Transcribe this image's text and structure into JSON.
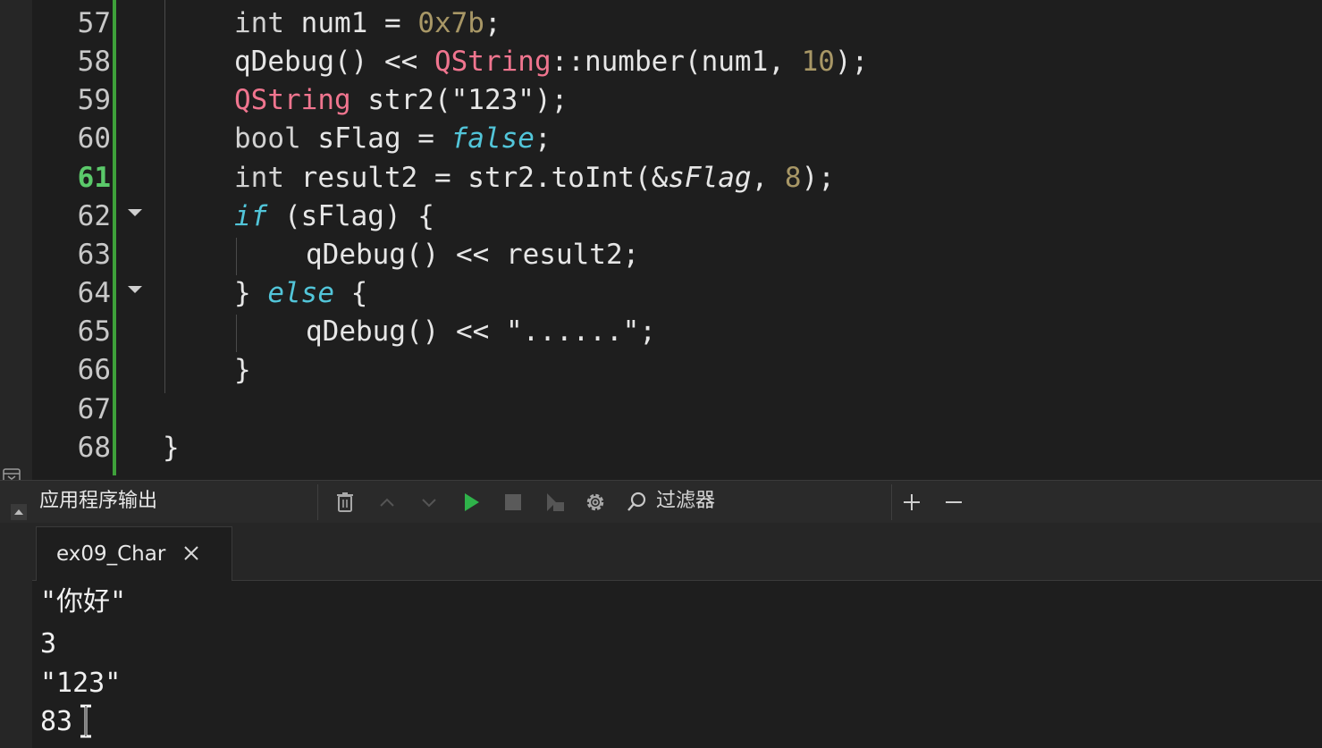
{
  "editor": {
    "lines": [
      {
        "number": "57",
        "tokens": {
          "a": "int",
          "b": " num1 = ",
          "c": "0x7b",
          "d": ";"
        }
      },
      {
        "number": "58",
        "tokens": {
          "a": "qDebug() << ",
          "b": "QString",
          "c": "::number(num1, ",
          "d": "10",
          "e": ");"
        }
      },
      {
        "number": "59",
        "tokens": {
          "a": "QString",
          "b": " str2(\"123\");"
        }
      },
      {
        "number": "60",
        "tokens": {
          "a": "bool",
          "b": " sFlag = ",
          "c": "false",
          "d": ";"
        }
      },
      {
        "number": "61",
        "tokens": {
          "a": "int",
          "b": " result2 = str2.toInt(&",
          "c": "sFlag",
          "d": ", ",
          "e": "8",
          "f": ");"
        }
      },
      {
        "number": "62",
        "tokens": {
          "a": "if",
          "b": " (sFlag) {"
        }
      },
      {
        "number": "63",
        "tokens": {
          "a": "qDebug() << result2;"
        }
      },
      {
        "number": "64",
        "tokens": {
          "a": "} ",
          "b": "else",
          "c": " {"
        }
      },
      {
        "number": "65",
        "tokens": {
          "a": "qDebug() << \"......\";"
        }
      },
      {
        "number": "66",
        "tokens": {
          "a": "}"
        }
      },
      {
        "number": "67",
        "tokens": {}
      },
      {
        "number": "68",
        "tokens": {
          "a": "}"
        }
      }
    ],
    "current_line": "61",
    "colors": {
      "keyword_italic": "#52c5d9",
      "type": "#f0758f",
      "number": "#a89766",
      "change_bar": "#3ea13a",
      "current_line_number": "#5bc96a"
    }
  },
  "output_panel": {
    "title": "应用程序输出",
    "toolbar_icons": [
      "trash-icon",
      "chevron-up-icon",
      "chevron-down-icon",
      "play-icon",
      "stop-icon",
      "attach-icon",
      "gear-icon",
      "search-icon",
      "plus-icon",
      "minus-icon"
    ],
    "filter_label": "过滤器",
    "tab": {
      "label": "ex09_Char",
      "close_icon": "close-icon"
    },
    "output_lines": [
      "\"你好\"",
      "3",
      "\"123\"",
      "83"
    ]
  }
}
